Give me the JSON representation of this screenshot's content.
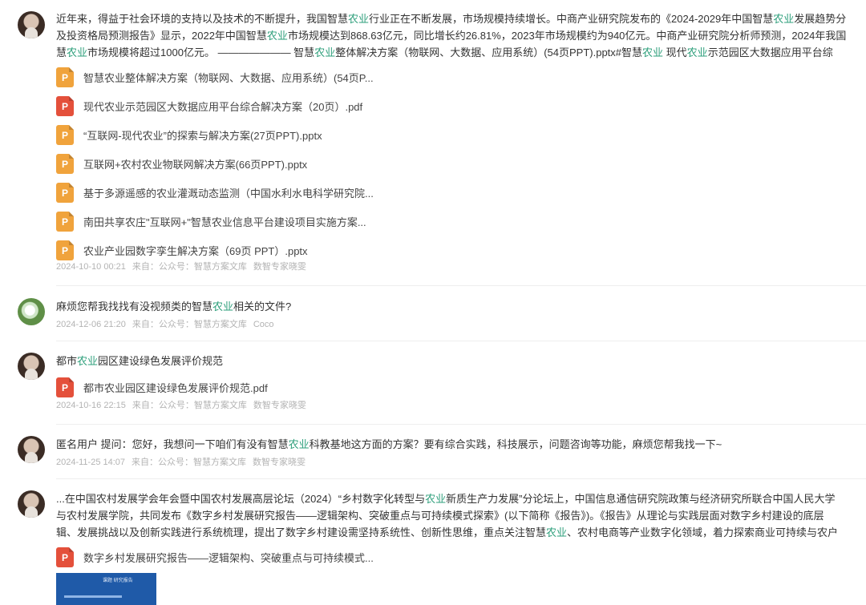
{
  "posts": [
    {
      "text_parts": [
        {
          "t": "近年来，得益于社会环境的支持以及技术的不断提升，我国智慧",
          "h": false
        },
        {
          "t": "农业",
          "h": true
        },
        {
          "t": "行业正在不断发展，市场规模持续增长。中商产业研究院发布的《2024-2029年中国智慧",
          "h": false
        },
        {
          "t": "农业",
          "h": true
        },
        {
          "t": "发展趋势分",
          "h": false
        }
      ],
      "text_parts2": [
        {
          "t": "及投资格局预测报告》显示，2022年中国智慧",
          "h": false
        },
        {
          "t": "农业",
          "h": true
        },
        {
          "t": "市场规模达到868.63亿元，同比增长约26.81%，2023年市场规模约为940亿元。中商产业研究院分析师预测，2024年我国",
          "h": false
        }
      ],
      "text_parts3": [
        {
          "t": "慧",
          "h": false
        },
        {
          "t": "农业",
          "h": true
        },
        {
          "t": "市场规模将超过1000亿元。 ——————— 智慧",
          "h": false
        },
        {
          "t": "农业",
          "h": true
        },
        {
          "t": "整体解决方案（物联网、大数据、应用系统）(54页PPT).pptx#智慧",
          "h": false
        },
        {
          "t": "农业",
          "h": true
        },
        {
          "t": "  现代",
          "h": false
        },
        {
          "t": "农业",
          "h": true
        },
        {
          "t": "示范园区大数据应用平台综",
          "h": false
        }
      ],
      "files": [
        {
          "type": "P",
          "kind": "ppt",
          "name": "智慧农业整体解决方案（物联网、大数据、应用系统）(54页P..."
        },
        {
          "type": "P",
          "kind": "pdf",
          "name": "现代农业示范园区大数据应用平台综合解决方案（20页）.pdf"
        },
        {
          "type": "P",
          "kind": "ppt",
          "name": "“互联网-现代农业”的探索与解决方案(27页PPT).pptx"
        },
        {
          "type": "P",
          "kind": "ppt",
          "name": "互联网+农村农业物联网解决方案(66页PPT).pptx"
        },
        {
          "type": "P",
          "kind": "ppt",
          "name": "基于多源遥感的农业灌溉动态监测（中国水利水电科学研究院..."
        },
        {
          "type": "P",
          "kind": "ppt",
          "name": "南田共享农庄\"互联网+\"智慧农业信息平台建设项目实施方案..."
        },
        {
          "type": "P",
          "kind": "ppt",
          "name": "农业产业园数字孪生解决方案（69页 PPT）.pptx"
        }
      ],
      "meta": {
        "date": "2024-10-10 00:21",
        "from": "来自：",
        "source": "公众号：智慧方案文库",
        "author": "数智专家晓雯"
      }
    },
    {
      "text_parts": [
        {
          "t": "麻烦您帮我找找有没视频类的智慧",
          "h": false
        },
        {
          "t": "农业",
          "h": true
        },
        {
          "t": "相关的文件?",
          "h": false
        }
      ],
      "meta": {
        "date": "2024-12-06 21:20",
        "from": "来自：",
        "source": "公众号：智慧方案文库",
        "author": "Coco"
      }
    },
    {
      "text_parts": [
        {
          "t": "都市",
          "h": false
        },
        {
          "t": "农业",
          "h": true
        },
        {
          "t": "园区建设绿色发展评价规范",
          "h": false
        }
      ],
      "files": [
        {
          "type": "P",
          "kind": "pdf",
          "name": "都市农业园区建设绿色发展评价规范.pdf"
        }
      ],
      "meta": {
        "date": "2024-10-16 22:15",
        "from": "来自：",
        "source": "公众号：智慧方案文库",
        "author": "数智专家晓雯"
      }
    },
    {
      "text_parts": [
        {
          "t": "匿名用户 提问：您好，我想问一下咱们有没有智慧",
          "h": false
        },
        {
          "t": "农业",
          "h": true
        },
        {
          "t": "科教基地这方面的方案？要有综合实践，科技展示，问题咨询等功能，麻烦您帮我找一下~",
          "h": false
        }
      ],
      "meta": {
        "date": "2024-11-25 14:07",
        "from": "来自：",
        "source": "公众号：智慧方案文库",
        "author": "数智专家晓雯"
      }
    },
    {
      "text_parts": [
        {
          "t": "...在中国农村发展学会年会暨中国农村发展高层论坛（2024）“乡村数字化转型与",
          "h": false
        },
        {
          "t": "农业",
          "h": true
        },
        {
          "t": "新质生产力发展”分论坛上，中国信息通信研究院政策与经济研究所联合中国人民大学",
          "h": false
        }
      ],
      "text_parts2": [
        {
          "t": "与农村发展学院，共同发布《数字乡村发展研究报告——逻辑架构、突破重点与可持续模式探索》(以下简称《报告》)。《报告》从理论与实践层面对数字乡村建设的底层",
          "h": false
        }
      ],
      "text_parts3": [
        {
          "t": "辑、发展挑战以及创新实践进行系统梳理，提出了数字乡村建设需坚持系统性、创新性思维，重点关注智慧",
          "h": false
        },
        {
          "t": "农业",
          "h": true
        },
        {
          "t": "、农村电商等产业数字化领域，着力探索商业可持续与农户",
          "h": false
        }
      ],
      "files": [
        {
          "type": "P",
          "kind": "pdf",
          "name": "数字乡村发展研究报告——逻辑架构、突破重点与可持续模式..."
        }
      ],
      "thumb_text": "课题 研究报告"
    }
  ]
}
